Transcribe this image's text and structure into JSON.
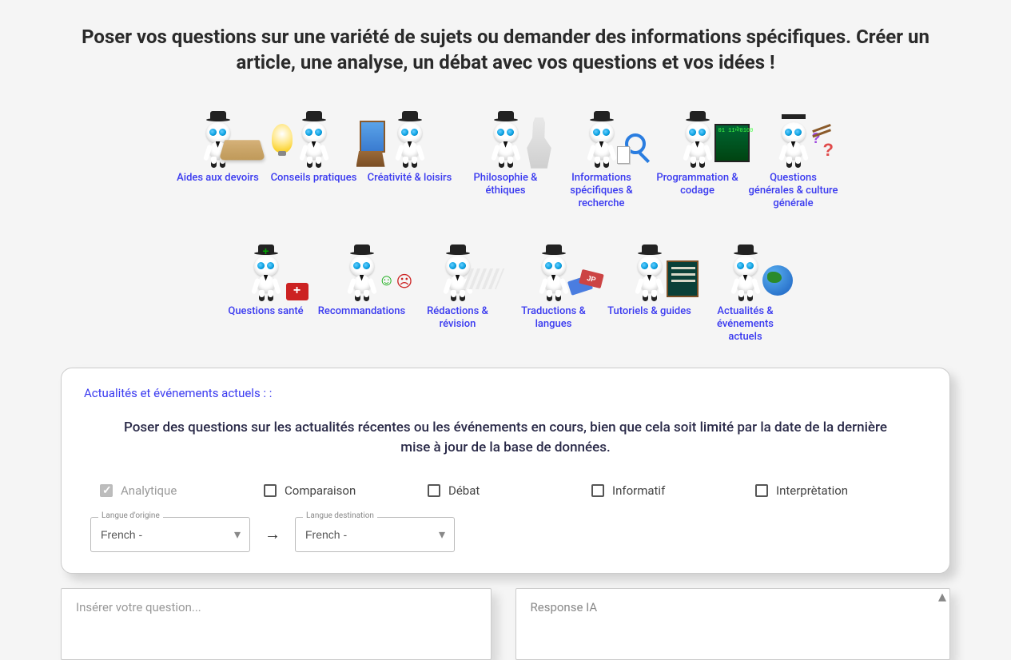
{
  "page": {
    "title": "Poser vos questions sur une variété de sujets ou demander des informations spécifiques. Créer un article, une analyse, un débat avec vos questions et vos idées !"
  },
  "categories": [
    {
      "id": "homework",
      "label": "Aides aux devoirs"
    },
    {
      "id": "practical",
      "label": "Conseils pratiques"
    },
    {
      "id": "creativity",
      "label": "Créativité & loisirs"
    },
    {
      "id": "philosophy",
      "label": "Philosophie & éthiques"
    },
    {
      "id": "research",
      "label": "Informations spécifiques & recherche"
    },
    {
      "id": "programming",
      "label": "Programmation & codage"
    },
    {
      "id": "general",
      "label": "Questions générales & culture générale"
    },
    {
      "id": "health",
      "label": "Questions santé"
    },
    {
      "id": "recommend",
      "label": "Recommandations"
    },
    {
      "id": "writing",
      "label": "Rédactions & révision"
    },
    {
      "id": "translate",
      "label": "Traductions & langues"
    },
    {
      "id": "tutorials",
      "label": "Tutoriels & guides"
    },
    {
      "id": "news",
      "label": "Actualités & événements actuels"
    }
  ],
  "panel": {
    "title": "Actualités et événements actuels : :",
    "description": "Poser des questions sur les actualités récentes ou les événements en cours, bien que cela soit limité par la date de la dernière mise à jour de la base de données.",
    "checks": {
      "analytique": "Analytique",
      "comparaison": "Comparaison",
      "debat": "Débat",
      "informatif": "Informatif",
      "interpretation": "Interprètation"
    },
    "lang_origin_label": "Langue d'origine",
    "lang_dest_label": "Langue destination",
    "lang_origin_value": "French -",
    "lang_dest_value": "French -"
  },
  "io": {
    "question_placeholder": "Insérer votre question...",
    "response_label": "Response IA"
  }
}
